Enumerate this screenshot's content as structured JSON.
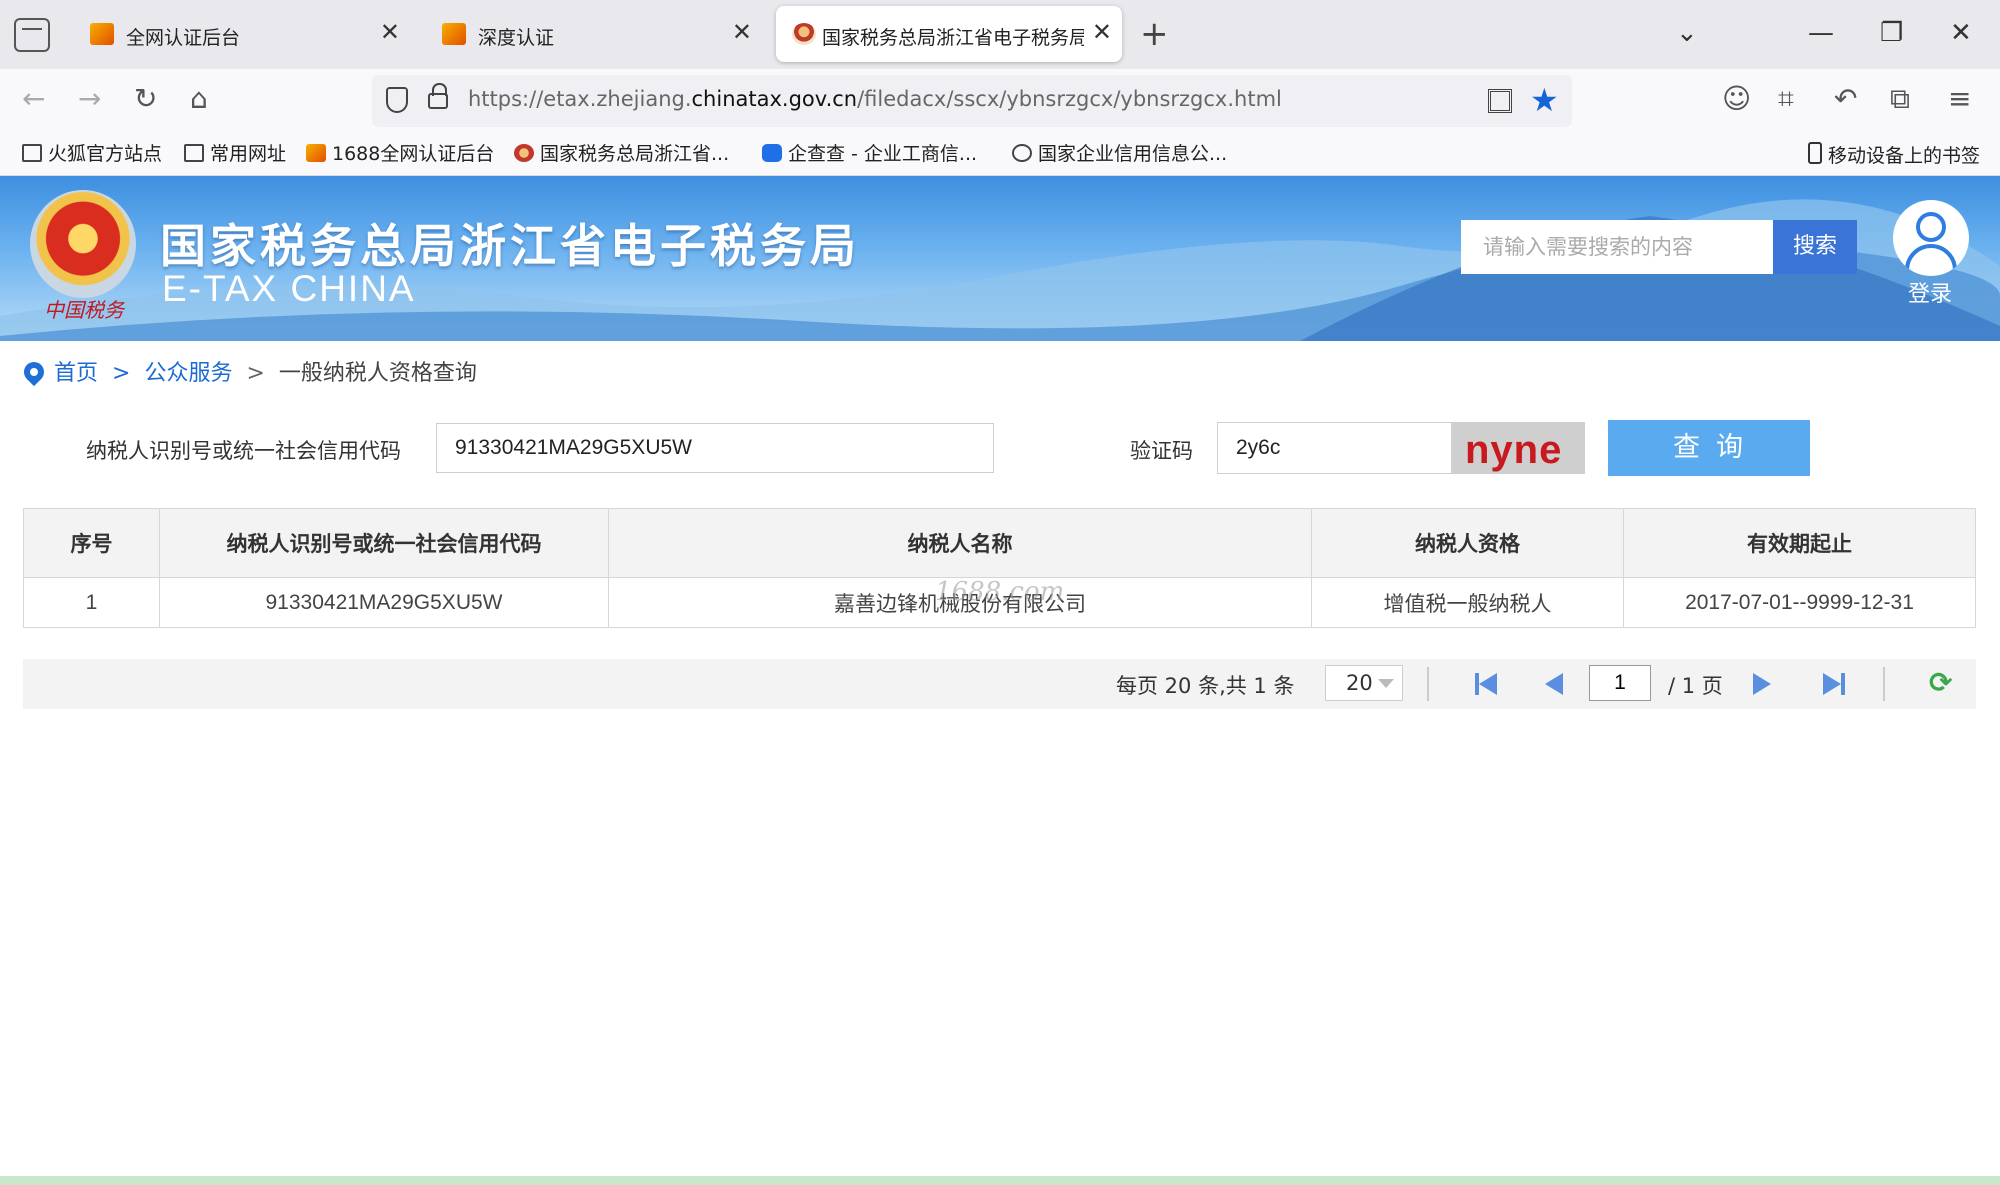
{
  "browser": {
    "tabs": [
      {
        "title": "全网认证后台",
        "active": false
      },
      {
        "title": "深度认证",
        "active": false
      },
      {
        "title": "国家税务总局浙江省电子税务局",
        "active": true
      }
    ],
    "url_prefix": "https://etax.zhejiang.",
    "url_domain": "chinatax.gov.cn",
    "url_path": "/filedacx/sscx/ybnsrzgcx/ybnsrzgcx.html",
    "bookmarks": [
      {
        "label": "火狐官方站点",
        "icon": "folder-icon"
      },
      {
        "label": "常用网址",
        "icon": "folder-icon"
      },
      {
        "label": "1688全网认证后台",
        "icon": "favicon-orange"
      },
      {
        "label": "国家税务总局浙江省...",
        "icon": "favicon-tax"
      },
      {
        "label": "企查查 - 企业工商信...",
        "icon": "favicon-qcc"
      },
      {
        "label": "国家企业信用信息公...",
        "icon": "globe-icon"
      }
    ],
    "mobile_bookmarks": "移动设备上的书签"
  },
  "site": {
    "title": "国家税务总局浙江省电子税务局",
    "subtitle": "E-TAX CHINA",
    "emblem_caption": "中国税务",
    "search_placeholder": "请输入需要搜索的内容",
    "search_button": "搜索",
    "login": "登录"
  },
  "breadcrumb": {
    "home": "首页",
    "sep": ">",
    "section": "公众服务",
    "current": "一般纳税人资格查询"
  },
  "form": {
    "taxpayer_id_label": "纳税人识别号或统一社会信用代码",
    "taxpayer_id_value": "91330421MA29G5XU5W",
    "captcha_label": "验证码",
    "captcha_value": "2y6c",
    "captcha_image_text": "nyne",
    "query_button": "查询"
  },
  "table": {
    "headers": [
      "序号",
      "纳税人识别号或统一社会信用代码",
      "纳税人名称",
      "纳税人资格",
      "有效期起止"
    ],
    "rows": [
      [
        "1",
        "91330421MA29G5XU5W",
        "嘉善边锋机械股份有限公司",
        "增值税一般纳税人",
        "2017-07-01--9999-12-31"
      ]
    ],
    "watermark": "1688.com"
  },
  "pager": {
    "info": "每页 20 条,共 1 条",
    "page_size": "20",
    "current_page": "1",
    "total": "/ 1 页"
  },
  "colors": {
    "brand_blue": "#1c6bd3",
    "query_button": "#5aaaf0",
    "search_button": "#3a74d6",
    "captcha_text": "#c8191f"
  }
}
